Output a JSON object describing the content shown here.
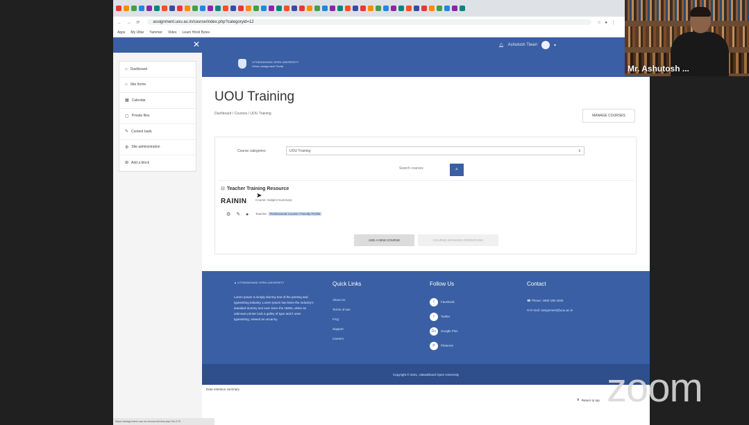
{
  "browser": {
    "url": "assignment.uou.ac.in/course/index.php?categoryid=12",
    "bookmarks": [
      "Apps",
      "My Uttar",
      "Yammer",
      "Video",
      "Learn Hindi Bytes"
    ]
  },
  "navbar": {
    "close_glyph": "✕",
    "user_name": "Ashutosh Tiwari"
  },
  "sidebar": {
    "items": [
      {
        "icon": "⌂",
        "label": "Dashboard"
      },
      {
        "icon": "⌂",
        "label": "Site home"
      },
      {
        "icon": "▦",
        "label": "Calendar"
      },
      {
        "icon": "▢",
        "label": "Private files"
      },
      {
        "icon": "✎",
        "label": "Content bank"
      },
      {
        "icon": "⚙",
        "label": "Site administration"
      },
      {
        "icon": "⊞",
        "label": "Add a block"
      }
    ]
  },
  "banner": {
    "logo_line1": "UTTARAKHAND OPEN UNIVERSITY",
    "logo_line2": "Online Assignment Portal"
  },
  "page": {
    "title": "UOU Training",
    "breadcrumb": "Dashboard / Courses / UOU Training",
    "manage_courses": "MANAGE COURSES",
    "category_label": "Course categories",
    "category_selected": "UOU Training",
    "search_placeholder": "Search courses",
    "search_glyph": "⌕",
    "add_course": "ADD A NEW COURSE",
    "sort_courses": "COURSE-SPANNED OPERATIONS"
  },
  "course": {
    "name": "Teacher Training Resource",
    "image_text": "RAININ",
    "summary": "Course: Subject Summary",
    "teacher_prefix": "Teacher:",
    "teacher_selected": "Professional Course / Faculty Profile"
  },
  "footer": {
    "logo_text": "UTTARAKHAND OPEN UNIVERSITY",
    "about": "Lorem Ipsum is simply dummy text of the printing and typesetting industry. Lorem Ipsum has been the industry's standard dummy text ever since the 1500s, when an unknown printer took a galley of type and it uses typesetting, viewed as uncanny.",
    "quick_links_title": "Quick Links",
    "quick_links": [
      "About Us",
      "Terms of use",
      "FAQ",
      "Support",
      "Careers"
    ],
    "follow_title": "Follow Us",
    "social": [
      {
        "glyph": "f",
        "label": "Facebook"
      },
      {
        "glyph": "t",
        "label": "Twitter"
      },
      {
        "glyph": "G+",
        "label": "Google Plus"
      },
      {
        "glyph": "P",
        "label": "Pinterest"
      }
    ],
    "contact_title": "Contact",
    "phone": "Phone: 1800 180 4025",
    "email": "E-mail: assignment@uou.ac.in",
    "copyright": "Copyright © 2021, Uttarakhand Open University"
  },
  "below_footer": {
    "data_retention": "Data retention summary",
    "return_top": "Return to top"
  },
  "statusbar": {
    "text": "https://assignment.uou.ac.in/course/view.php?id=170"
  },
  "zoom": {
    "participant_name": "Mr. Ashutosh ...",
    "logo": "zoom"
  }
}
